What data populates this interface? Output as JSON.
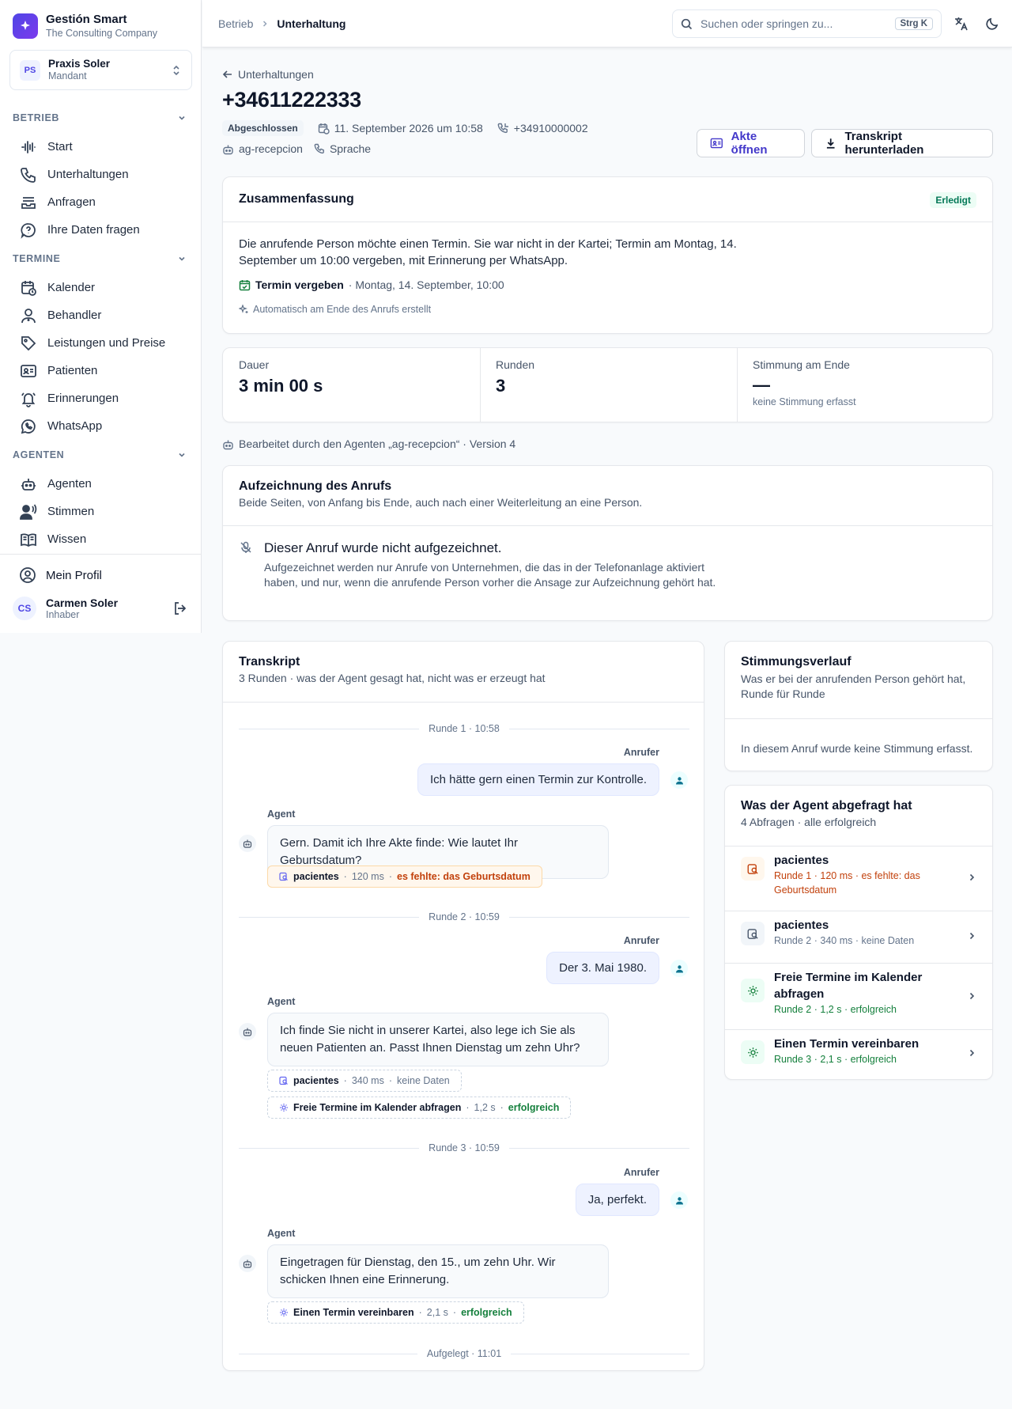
{
  "brand": {
    "name": "Gestión Smart",
    "subtitle": "The Consulting Company"
  },
  "tenant": {
    "initials": "PS",
    "name": "Praxis Soler",
    "role": "Mandant"
  },
  "nav": {
    "betrieb": {
      "label": "BETRIEB",
      "items": [
        "Start",
        "Unterhaltungen",
        "Anfragen",
        "Ihre Daten fragen"
      ]
    },
    "termine": {
      "label": "TERMINE",
      "items": [
        "Kalender",
        "Behandler",
        "Leistungen und Preise",
        "Patienten",
        "Erinnerungen",
        "WhatsApp"
      ]
    },
    "agenten": {
      "label": "AGENTEN",
      "items": [
        "Agenten",
        "Stimmen",
        "Wissen"
      ]
    }
  },
  "profile": {
    "label": "Mein Profil"
  },
  "user": {
    "initials": "CS",
    "name": "Carmen Soler",
    "role": "Inhaber"
  },
  "breadcrumb": {
    "parent": "Betrieb",
    "current": "Unterhaltung"
  },
  "search": {
    "placeholder": "Suchen oder springen zu...",
    "shortcut": "Strg K"
  },
  "header": {
    "back": "Unterhaltungen",
    "title": "+34611222333",
    "status": "Abgeschlossen",
    "datetime": "11. September 2026 um 10:58",
    "phone": "+34910000002",
    "agent": "ag-recepcion",
    "channel": "Sprache",
    "btn_file": "Akte öffnen",
    "btn_download": "Transkript herunterladen"
  },
  "summary": {
    "title": "Zusammenfassung",
    "badge": "Erledigt",
    "text": "Die anrufende Person möchte einen Termin. Sie war nicht in der Kartei; Termin am Montag, 14. September um 10:00 vergeben, mit Erinnerung per WhatsApp.",
    "outcome_label": "Termin vergeben",
    "outcome_detail": "· Montag, 14. September, 10:00",
    "auto_note": "Automatisch am Ende des Anrufs erstellt"
  },
  "stats": {
    "duration_label": "Dauer",
    "duration_value": "3 min 00 s",
    "rounds_label": "Runden",
    "rounds_value": "3",
    "mood_label": "Stimmung am Ende",
    "mood_value": "—",
    "mood_note": "keine Stimmung erfasst"
  },
  "agent_line": "Bearbeitet durch den Agenten „ag-recepcion“ · Version 4",
  "recording": {
    "title": "Aufzeichnung des Anrufs",
    "subtitle": "Beide Seiten, von Anfang bis Ende, auch nach einer Weiterleitung an eine Person.",
    "message": "Dieser Anruf wurde nicht aufgezeichnet.",
    "detail": "Aufgezeichnet werden nur Anrufe von Unternehmen, die das in der Telefonanlage aktiviert haben, und nur, wenn die anrufende Person vorher die Ansage zur Aufzeichnung gehört hat."
  },
  "transcript": {
    "title": "Transkript",
    "subtitle": "3 Runden · was der Agent gesagt hat, nicht was er erzeugt hat",
    "caller_label": "Anrufer",
    "agent_label": "Agent",
    "rounds": [
      {
        "label": "Runde 1 · 10:58",
        "caller": "Ich hätte gern einen Termin zur Kontrolle.",
        "agent": "Gern. Damit ich Ihre Akte finde: Wie lautet Ihr Geburtsdatum?",
        "tools": [
          {
            "name": "pacientes",
            "time": "120 ms",
            "status": "es fehlte: das Geburtsdatum"
          }
        ]
      },
      {
        "label": "Runde 2 · 10:59",
        "caller": "Der 3. Mai 1980.",
        "agent": "Ich finde Sie nicht in unserer Kartei, also lege ich Sie als neuen Patienten an. Passt Ihnen Dienstag um zehn Uhr?",
        "tools": [
          {
            "name": "pacientes",
            "time": "340 ms",
            "status": "keine Daten"
          },
          {
            "name": "Freie Termine im Kalender abfragen",
            "time": "1,2 s",
            "status": "erfolgreich"
          }
        ]
      },
      {
        "label": "Runde 3 · 10:59",
        "caller": "Ja, perfekt.",
        "agent": "Eingetragen für Dienstag, den 15., um zehn Uhr. Wir schicken Ihnen eine Erinnerung.",
        "tools": [
          {
            "name": "Einen Termin vereinbaren",
            "time": "2,1 s",
            "status": "erfolgreich"
          }
        ]
      }
    ],
    "end": "Aufgelegt · 11:01"
  },
  "mood": {
    "title": "Stimmungsverlauf",
    "subtitle": "Was er bei der anrufenden Person gehört hat, Runde für Runde",
    "empty": "In diesem Anruf wurde keine Stimmung erfasst."
  },
  "queries": {
    "title": "Was der Agent abgefragt hat",
    "subtitle": "4 Abfragen · alle erfolgreich",
    "items": [
      {
        "name": "pacientes",
        "detail": "Runde 1 · 120 ms · es fehlte: das Geburtsdatum"
      },
      {
        "name": "pacientes",
        "detail": "Runde 2 · 340 ms · keine Daten"
      },
      {
        "name": "Freie Termine im Kalender abfragen",
        "detail": "Runde 2 · 1,2 s · erfolgreich"
      },
      {
        "name": "Einen Termin vereinbaren",
        "detail": "Runde 3 · 2,1 s · erfolgreich"
      }
    ]
  }
}
